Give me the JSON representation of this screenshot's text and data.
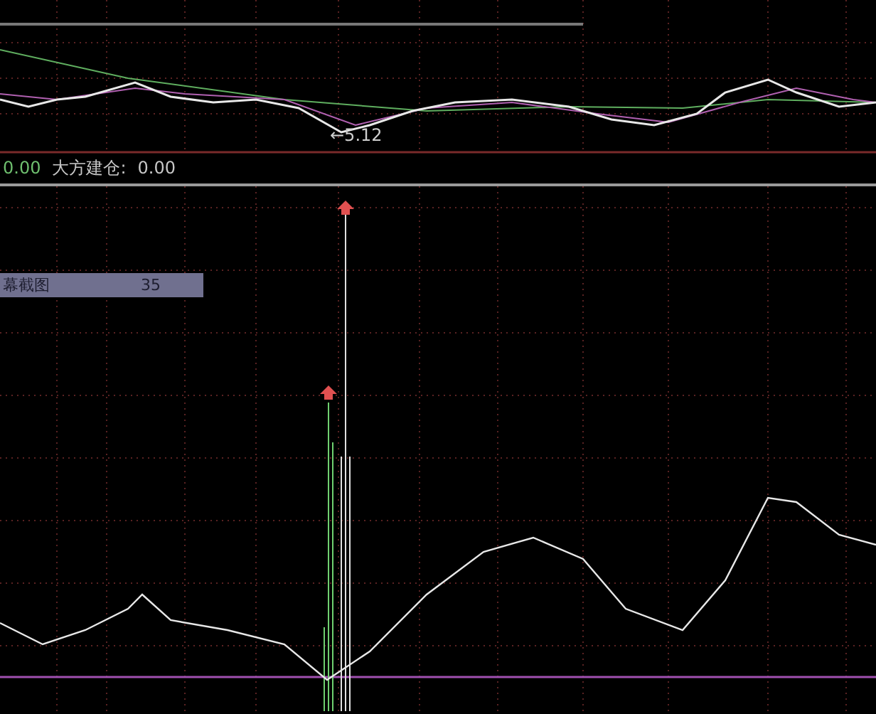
{
  "price_panel": {
    "low_label": "←5.12"
  },
  "indicator_header": {
    "value": "0.00",
    "name": "大方建仓:",
    "reading": "0.00"
  },
  "indicator_panel": {
    "tooltip": {
      "label": "幕截图",
      "value": "35"
    }
  }
}
